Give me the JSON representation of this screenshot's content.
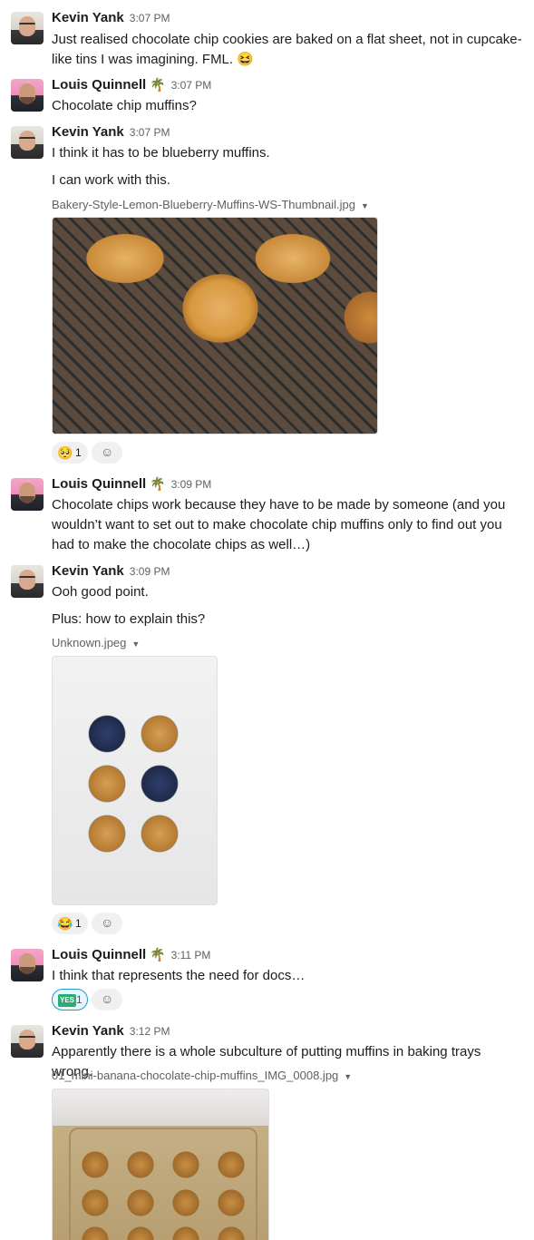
{
  "colors": {
    "text": "#1d1c1d",
    "muted": "#616061",
    "link": "#1264a3",
    "yes_green": "#2bac76"
  },
  "messages": [
    {
      "author": "Kevin Yank",
      "time": "3:07 PM",
      "lines": [
        "Just realised chocolate chip cookies are baked on a flat sheet, not in cupcake-like tins I was imagining. FML. 😆"
      ]
    },
    {
      "author": "Louis Quinnell",
      "status_emoji": "🌴",
      "time": "3:07 PM",
      "lines": [
        "Chocolate chip muffins?"
      ]
    },
    {
      "author": "Kevin Yank",
      "time": "3:07 PM",
      "lines": [
        "I think it has to be blueberry muffins.",
        "I can work with this."
      ],
      "file": "Bakery-Style-Lemon-Blueberry-Muffins-WS-Thumbnail.jpg",
      "reactions": [
        {
          "emoji": "🥺",
          "count": "1"
        }
      ]
    },
    {
      "author": "Louis Quinnell",
      "status_emoji": "🌴",
      "time": "3:09 PM",
      "lines": [
        "Chocolate chips work because they have to be made by someone (and you wouldn’t want to set out to make chocolate chip muffins only to find out you had to make the chocolate chips as well…)"
      ]
    },
    {
      "author": "Kevin Yank",
      "time": "3:09 PM",
      "lines": [
        "Ooh good point.",
        "Plus: how to explain this?"
      ],
      "file": "Unknown.jpeg",
      "reactions": [
        {
          "emoji": "😂",
          "count": "1"
        }
      ]
    },
    {
      "author": "Louis Quinnell",
      "status_emoji": "🌴",
      "time": "3:11 PM",
      "lines": [
        "I think that represents the need for docs…"
      ],
      "reactions": [
        {
          "emoji": "YES",
          "count": "1"
        }
      ]
    },
    {
      "author": "Kevin Yank",
      "time": "3:12 PM",
      "lines": [
        "Apparently there is a whole subculture of putting muffins in baking trays wrong."
      ],
      "file": "01_mini-banana-chocolate-chip-muffins_IMG_0008.jpg"
    }
  ],
  "icons": {
    "add_reaction": "add-reaction-icon",
    "file_menu": "chevron-down-icon"
  },
  "add_reaction_glyph": "☺",
  "caret_glyph": "▼"
}
